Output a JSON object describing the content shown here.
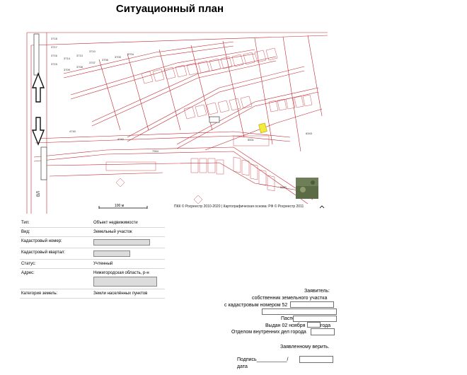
{
  "title": "Ситуационный план",
  "map": {
    "copyright": "ПКК © Росреестр 2010-2020 | Картографическая основа: РФ © Росреестр 2011",
    "scale": "100 м",
    "parcel_labels": [
      "3718",
      "3717",
      "3716",
      "3715",
      "3714",
      "3713",
      "3710",
      "3709",
      "3708",
      "3707",
      "3706",
      "3705",
      "3704",
      "4740",
      "4742",
      "7964",
      "6343",
      "5001",
      "6683",
      "ВЛ"
    ],
    "thumbnail_icon": "satellite-thumbnail-icon",
    "north_arrow_icon": "north-arrow-icon"
  },
  "info": [
    {
      "label": "Тип:",
      "value": "Объект недвижимости",
      "redacted": false
    },
    {
      "label": "Вид:",
      "value": "Земельный участок",
      "redacted": false
    },
    {
      "label": "Кадастровый номер:",
      "value": "",
      "redacted": true
    },
    {
      "label": "Кадастровый квартал:",
      "value": "",
      "redacted": true
    },
    {
      "label": "Статус:",
      "value": "Учтенный",
      "redacted": false
    },
    {
      "label": "Адрес:",
      "value": "Нижегородская область, р-н",
      "redacted": true
    },
    {
      "label": "Категория земель:",
      "value": "Земли населённых пунктов",
      "redacted": false
    }
  ],
  "statement": {
    "applicant": "Заявитель:",
    "owner": "собственник земельного участка",
    "cadastre": "с кадастровым номером 52",
    "passport": "Паспорт",
    "issued": "Выдан 02 ноября",
    "year_suffix": "года",
    "department": "Отделом внутренних дел города",
    "verify": "Заявленному верить.",
    "signature": "Подпись___________/",
    "date": "дата"
  }
}
